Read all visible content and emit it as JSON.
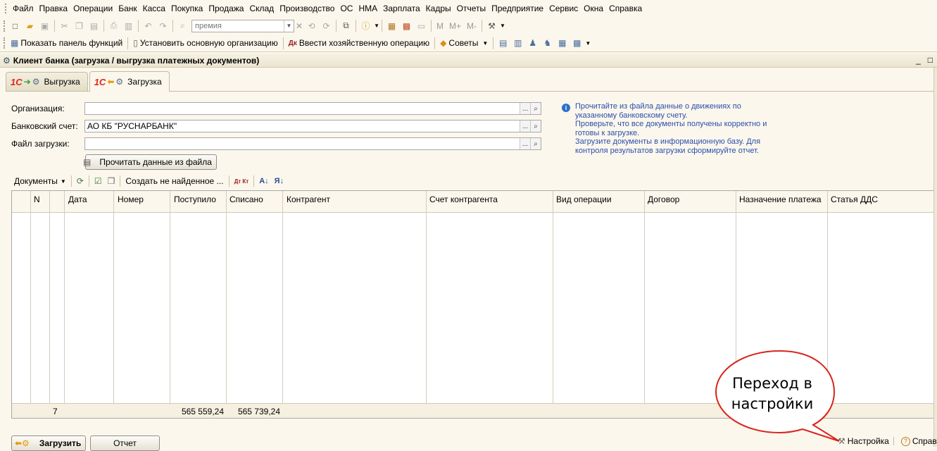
{
  "menu": [
    "Файл",
    "Правка",
    "Операции",
    "Банк",
    "Касса",
    "Покупка",
    "Продажа",
    "Склад",
    "Производство",
    "ОС",
    "НМА",
    "Зарплата",
    "Кадры",
    "Отчеты",
    "Предприятие",
    "Сервис",
    "Окна",
    "Справка"
  ],
  "toolbar1": {
    "search_value": "премия",
    "m_labels": [
      "M",
      "M+",
      "M-"
    ]
  },
  "toolbar2": {
    "show_panel": "Показать панель функций",
    "set_org": "Установить основную организацию",
    "enter_op": "Ввести хозяйственную операцию",
    "tips": "Советы"
  },
  "window": {
    "title": "Клиент банка (загрузка / выгрузка платежных документов)",
    "min": "_",
    "restore": "□"
  },
  "tabs": [
    {
      "label": "Выгрузка",
      "logo": "1С"
    },
    {
      "label": "Загрузка",
      "logo": "1С"
    }
  ],
  "form": {
    "org_label": "Организация:",
    "org_value": "",
    "account_label": "Банковский счет:",
    "account_value": "АО КБ \"РУСНАРБАНК\"",
    "file_label": "Файл загрузки:",
    "file_value": "",
    "select_btn": "...",
    "read_button": "Прочитать данные из файла"
  },
  "hint": [
    "Прочитайте из файла данные о движениях по",
    "указанному банковскому счету.",
    "Проверьте, что все  документы получены корректно и",
    "готовы к загрузке.",
    "Загрузите документы в информационную базу. Для",
    "контроля результатов загрузки сформируйте отчет."
  ],
  "table_toolbar": {
    "documents": "Документы",
    "create_missing": "Создать не найденное ...",
    "dt_kt": "Дт Кт"
  },
  "table": {
    "columns": [
      "N",
      "Дата",
      "Номер",
      "Поступило",
      "Списано",
      "Контрагент",
      "Счет контрагента",
      "Вид операции",
      "Договор",
      "Назначение платежа",
      "Статья ДДС"
    ],
    "footer": {
      "count": "7",
      "received": "565 559,24",
      "spent": "565 739,24"
    }
  },
  "bottom": {
    "load": "Загрузить",
    "report": "Отчет",
    "settings": "Настройка",
    "help": "Справка"
  },
  "callout": {
    "line1": "Переход в",
    "line2": "настройки"
  },
  "colors": {
    "background": "#fbf7ec",
    "hint_text": "#2b4eae",
    "callout_border": "#d8241c",
    "logo_red": "#e0261b"
  }
}
